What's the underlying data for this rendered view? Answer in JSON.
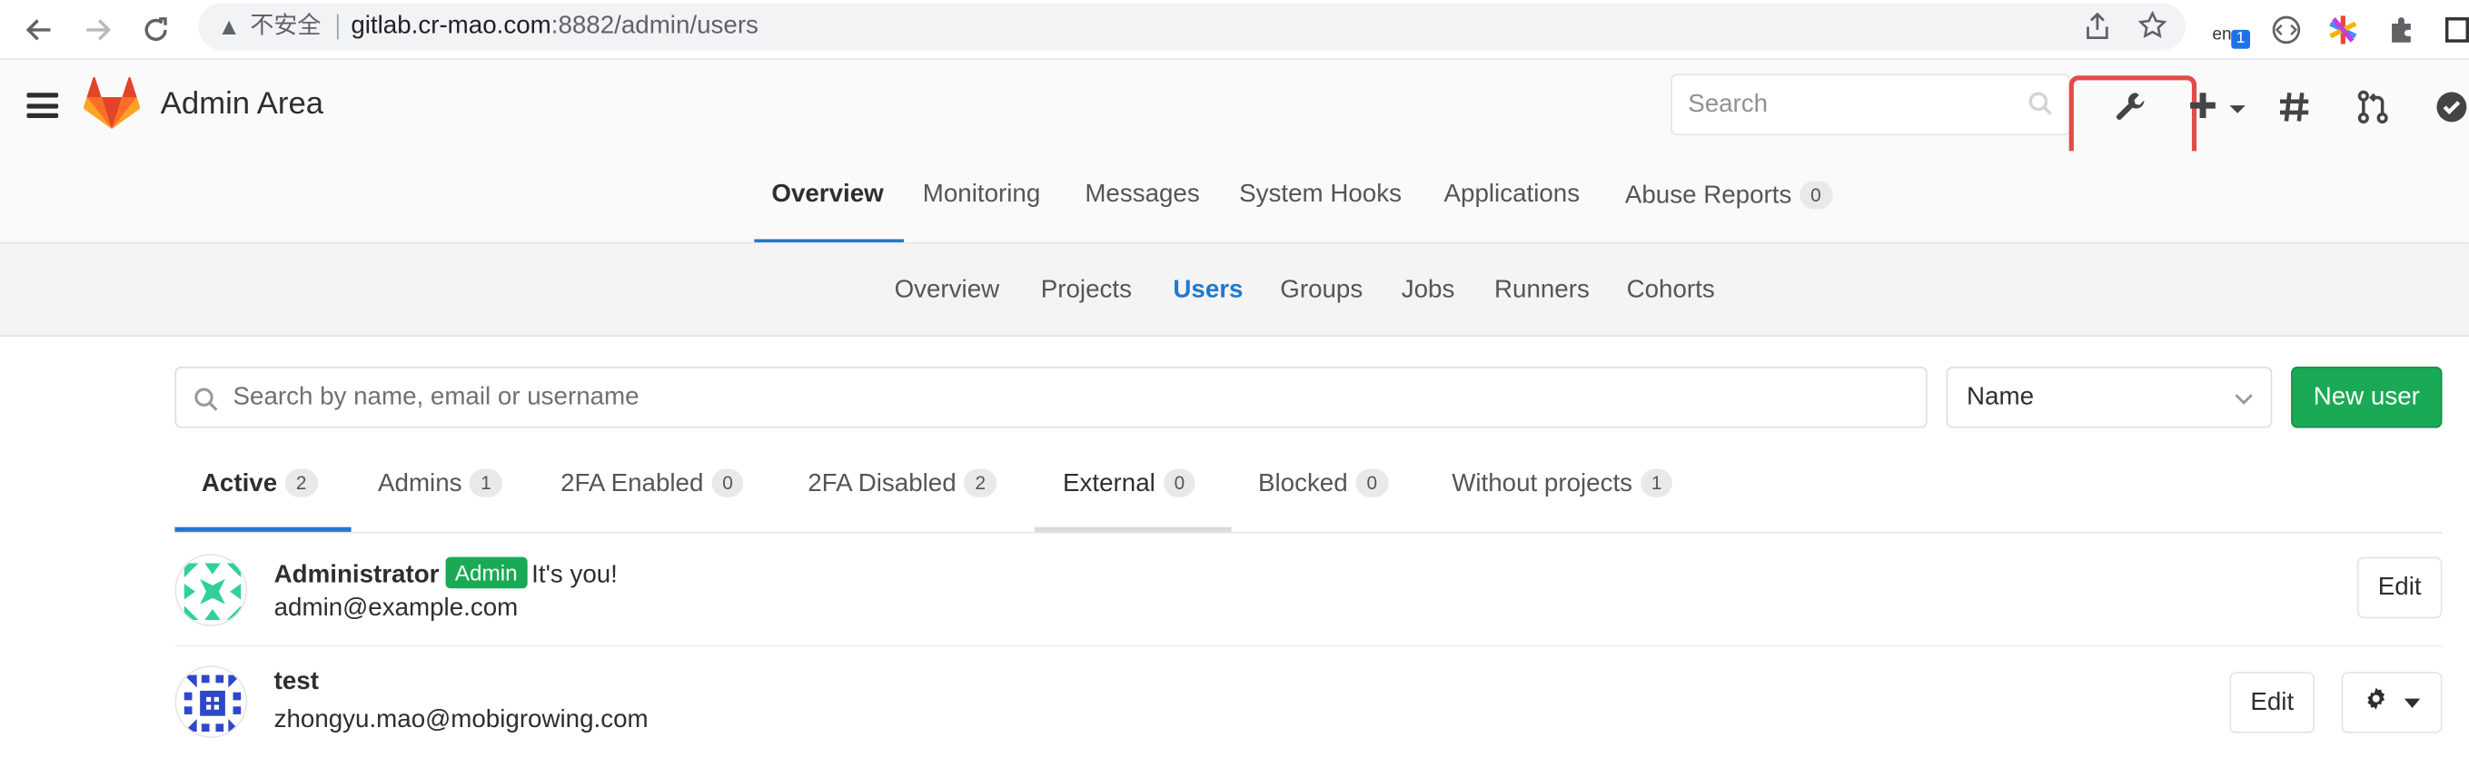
{
  "browser": {
    "url_warning": "不安全",
    "url_host": "gitlab.cr-mao.com",
    "url_path": ":8882/admin/users",
    "ext_lang": "en",
    "ext_badge": "1"
  },
  "header": {
    "brand": "Admin Area",
    "search_placeholder": "Search"
  },
  "top_tabs": [
    {
      "label": "Overview"
    },
    {
      "label": "Monitoring"
    },
    {
      "label": "Messages"
    },
    {
      "label": "System Hooks"
    },
    {
      "label": "Applications"
    },
    {
      "label": "Abuse Reports",
      "count": "0"
    }
  ],
  "sub_tabs": [
    {
      "label": "Overview"
    },
    {
      "label": "Projects"
    },
    {
      "label": "Users"
    },
    {
      "label": "Groups"
    },
    {
      "label": "Jobs"
    },
    {
      "label": "Runners"
    },
    {
      "label": "Cohorts"
    }
  ],
  "filters": {
    "search_placeholder": "Search by name, email or username",
    "sort_value": "Name",
    "new_user_label": "New user"
  },
  "user_tabs": [
    {
      "label": "Active",
      "count": "2"
    },
    {
      "label": "Admins",
      "count": "1"
    },
    {
      "label": "2FA Enabled",
      "count": "0"
    },
    {
      "label": "2FA Disabled",
      "count": "2"
    },
    {
      "label": "External",
      "count": "0"
    },
    {
      "label": "Blocked",
      "count": "0"
    },
    {
      "label": "Without projects",
      "count": "1"
    }
  ],
  "users": [
    {
      "name": "Administrator",
      "badge": "Admin",
      "note": "It's you!",
      "email": "admin@example.com",
      "edit_label": "Edit"
    },
    {
      "name": "test",
      "email": "zhongyu.mao@mobigrowing.com",
      "edit_label": "Edit"
    }
  ],
  "colors": {
    "accent_blue": "#1f78d1",
    "success_green": "#1aaa55",
    "highlight_red": "#e24b4b",
    "avatar1": "#2fd19b",
    "avatar2": "#2f47c9"
  }
}
